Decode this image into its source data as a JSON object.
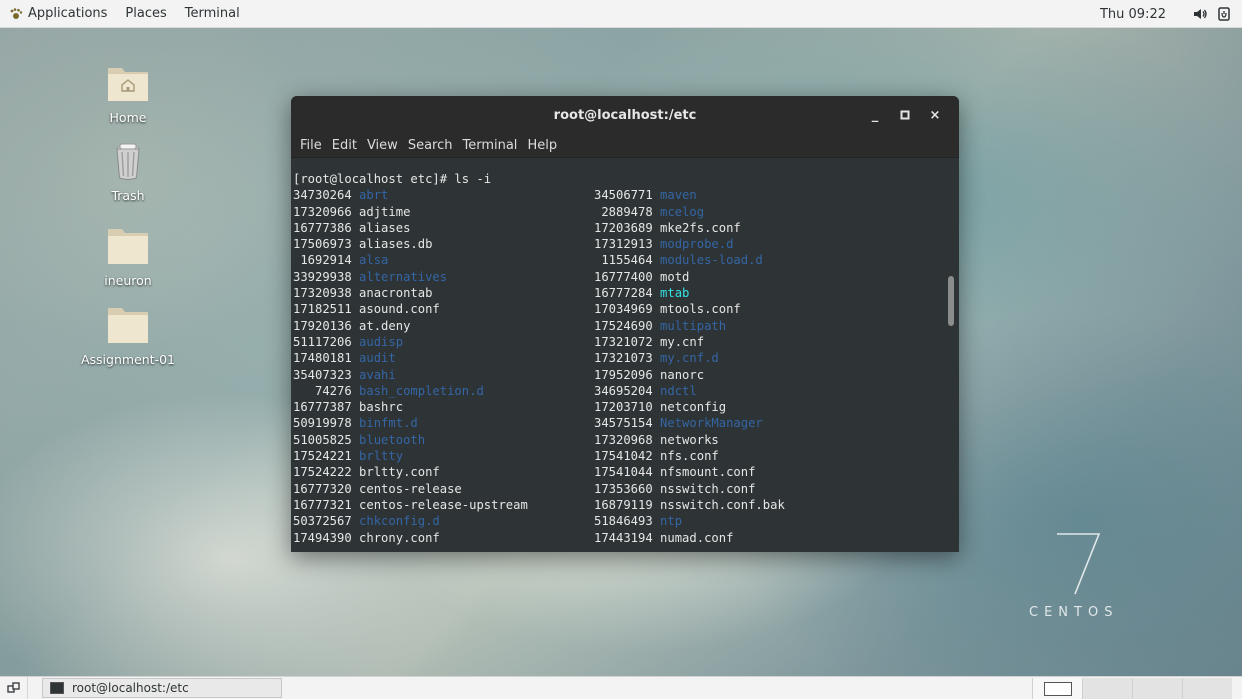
{
  "top_panel": {
    "menus": [
      "Applications",
      "Places",
      "Terminal"
    ],
    "clock": "Thu 09:22",
    "icons": [
      "volume-icon",
      "power-icon"
    ]
  },
  "desktop_icons": [
    {
      "label": "Home",
      "icon": "home-folder-icon"
    },
    {
      "label": "Trash",
      "icon": "trash-icon"
    },
    {
      "label": "ineuron",
      "icon": "folder-icon"
    },
    {
      "label": "Assignment-01",
      "icon": "folder-icon"
    }
  ],
  "terminal": {
    "title": "root@localhost:/etc",
    "controls": [
      "_",
      "▫",
      "×"
    ],
    "menubar": [
      "File",
      "Edit",
      "View",
      "Search",
      "Terminal",
      "Help"
    ],
    "prompt": "[root@localhost etc]# ls -i",
    "left_column": [
      {
        "inode": "34730264",
        "name": "abrt",
        "type": "dir"
      },
      {
        "inode": "17320966",
        "name": "adjtime",
        "type": "file"
      },
      {
        "inode": "16777386",
        "name": "aliases",
        "type": "file"
      },
      {
        "inode": "17506973",
        "name": "aliases.db",
        "type": "file"
      },
      {
        "inode": " 1692914",
        "name": "alsa",
        "type": "dir"
      },
      {
        "inode": "33929938",
        "name": "alternatives",
        "type": "dir"
      },
      {
        "inode": "17320938",
        "name": "anacrontab",
        "type": "file"
      },
      {
        "inode": "17182511",
        "name": "asound.conf",
        "type": "file"
      },
      {
        "inode": "17920136",
        "name": "at.deny",
        "type": "file"
      },
      {
        "inode": "51117206",
        "name": "audisp",
        "type": "dir"
      },
      {
        "inode": "17480181",
        "name": "audit",
        "type": "dir"
      },
      {
        "inode": "35407323",
        "name": "avahi",
        "type": "dir"
      },
      {
        "inode": "   74276",
        "name": "bash_completion.d",
        "type": "dir"
      },
      {
        "inode": "16777387",
        "name": "bashrc",
        "type": "file"
      },
      {
        "inode": "50919978",
        "name": "binfmt.d",
        "type": "dir"
      },
      {
        "inode": "51005825",
        "name": "bluetooth",
        "type": "dir"
      },
      {
        "inode": "17524221",
        "name": "brltty",
        "type": "dir"
      },
      {
        "inode": "17524222",
        "name": "brltty.conf",
        "type": "file"
      },
      {
        "inode": "16777320",
        "name": "centos-release",
        "type": "file"
      },
      {
        "inode": "16777321",
        "name": "centos-release-upstream",
        "type": "file"
      },
      {
        "inode": "50372567",
        "name": "chkconfig.d",
        "type": "dir"
      },
      {
        "inode": "17494390",
        "name": "chrony.conf",
        "type": "file"
      }
    ],
    "right_column": [
      {
        "inode": "34506771",
        "name": "maven",
        "type": "dir"
      },
      {
        "inode": " 2889478",
        "name": "mcelog",
        "type": "dir"
      },
      {
        "inode": "17203689",
        "name": "mke2fs.conf",
        "type": "file"
      },
      {
        "inode": "17312913",
        "name": "modprobe.d",
        "type": "dir"
      },
      {
        "inode": " 1155464",
        "name": "modules-load.d",
        "type": "dir"
      },
      {
        "inode": "16777400",
        "name": "motd",
        "type": "file"
      },
      {
        "inode": "16777284",
        "name": "mtab",
        "type": "link"
      },
      {
        "inode": "17034969",
        "name": "mtools.conf",
        "type": "file"
      },
      {
        "inode": "17524690",
        "name": "multipath",
        "type": "dir"
      },
      {
        "inode": "17321072",
        "name": "my.cnf",
        "type": "file"
      },
      {
        "inode": "17321073",
        "name": "my.cnf.d",
        "type": "dir"
      },
      {
        "inode": "17952096",
        "name": "nanorc",
        "type": "file"
      },
      {
        "inode": "34695204",
        "name": "ndctl",
        "type": "dir"
      },
      {
        "inode": "17203710",
        "name": "netconfig",
        "type": "file"
      },
      {
        "inode": "34575154",
        "name": "NetworkManager",
        "type": "dir"
      },
      {
        "inode": "17320968",
        "name": "networks",
        "type": "file"
      },
      {
        "inode": "17541042",
        "name": "nfs.conf",
        "type": "file"
      },
      {
        "inode": "17541044",
        "name": "nfsmount.conf",
        "type": "file"
      },
      {
        "inode": "17353660",
        "name": "nsswitch.conf",
        "type": "file"
      },
      {
        "inode": "16879119",
        "name": "nsswitch.conf.bak",
        "type": "file"
      },
      {
        "inode": "51846493",
        "name": "ntp",
        "type": "dir"
      },
      {
        "inode": "17443194",
        "name": "numad.conf",
        "type": "file"
      }
    ],
    "colors": {
      "dir": "#3465a4",
      "link": "#34e2e2",
      "file": "#e6e6e6",
      "background": "#2e3436"
    }
  },
  "branding": {
    "seven": "7",
    "text": "CENTOS"
  },
  "taskbar": {
    "task_label": "root@localhost:/etc",
    "workspaces": 4
  }
}
